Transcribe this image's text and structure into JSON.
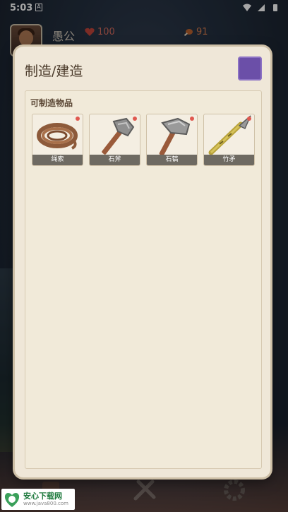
{
  "status_bar": {
    "time": "5:03"
  },
  "player": {
    "name": "愚公",
    "hp": "100",
    "food": "91"
  },
  "modal": {
    "title": "制造/建造",
    "section_title": "可制造物品",
    "items": [
      {
        "label": "绳索",
        "icon": "rope-icon"
      },
      {
        "label": "石斧",
        "icon": "stone-axe-icon"
      },
      {
        "label": "石镐",
        "icon": "stone-pickaxe-icon"
      },
      {
        "label": "竹矛",
        "icon": "bamboo-spear-icon"
      }
    ]
  },
  "colors": {
    "modal_bg": "#efe7d8",
    "close_square": "#6b4fa8",
    "item_label_bg": "#6e6a62",
    "badge_dot": "#e0584f"
  },
  "watermark": {
    "brand": "安心下载网",
    "site": "www.java800.com"
  }
}
